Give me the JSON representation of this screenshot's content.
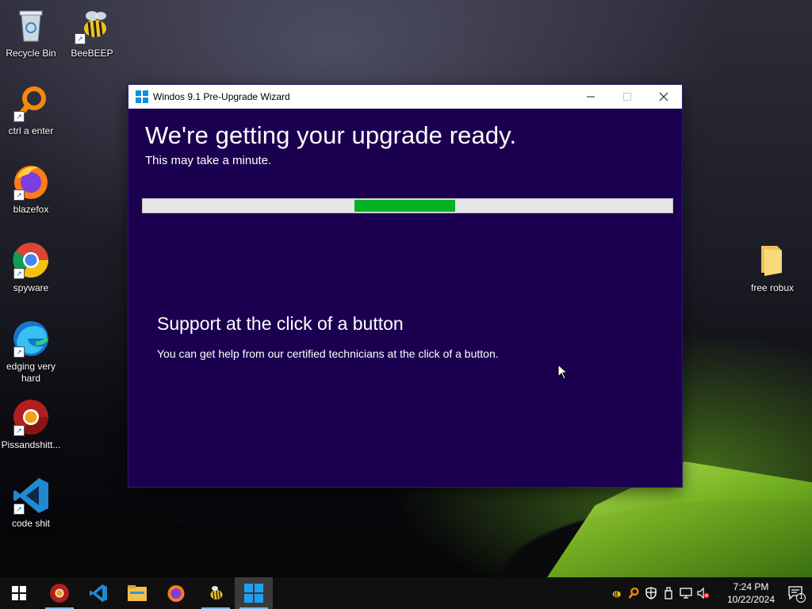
{
  "desktop": {
    "icons": [
      {
        "label": "Recycle Bin",
        "icon": "recycle-bin-icon",
        "shortcut": false
      },
      {
        "label": "BeeBEEP",
        "icon": "bee-icon",
        "shortcut": true
      },
      {
        "label": "ctrl a enter",
        "icon": "magnifier-icon",
        "shortcut": true
      },
      {
        "label": "blazefox",
        "icon": "firefox-icon",
        "shortcut": true
      },
      {
        "label": "spyware",
        "icon": "chrome-icon",
        "shortcut": true
      },
      {
        "label": "edging very hard",
        "icon": "edge-icon",
        "shortcut": true
      },
      {
        "label": "Pissandshitt...",
        "icon": "chrome-red-icon",
        "shortcut": true
      },
      {
        "label": "code shit",
        "icon": "vscode-icon",
        "shortcut": true
      },
      {
        "label": "free robux",
        "icon": "folder-icon",
        "shortcut": false
      }
    ]
  },
  "window": {
    "title": "Windos 9.1 Pre-Upgrade Wizard",
    "heading": "We're getting your upgrade ready.",
    "subheading": "This may take a minute.",
    "progress_state": "indeterminate",
    "support_title": "Support at the click of a button",
    "support_text": "You can get help from our certified technicians at the click of a button.",
    "colors": {
      "background": "#1b0050",
      "progress_fill": "#06b025"
    }
  },
  "taskbar": {
    "apps": [
      "start-button",
      "chrome-red-icon",
      "vscode-icon",
      "file-explorer-icon",
      "firefox-icon",
      "bee-icon",
      "windows-logo-icon"
    ],
    "tray_icons": [
      "bee-icon",
      "magnifier-icon",
      "shield-icon",
      "usb-icon",
      "network-icon",
      "volume-muted-icon"
    ],
    "time": "7:24 PM",
    "date": "10/22/2024",
    "notification_count": "1"
  }
}
